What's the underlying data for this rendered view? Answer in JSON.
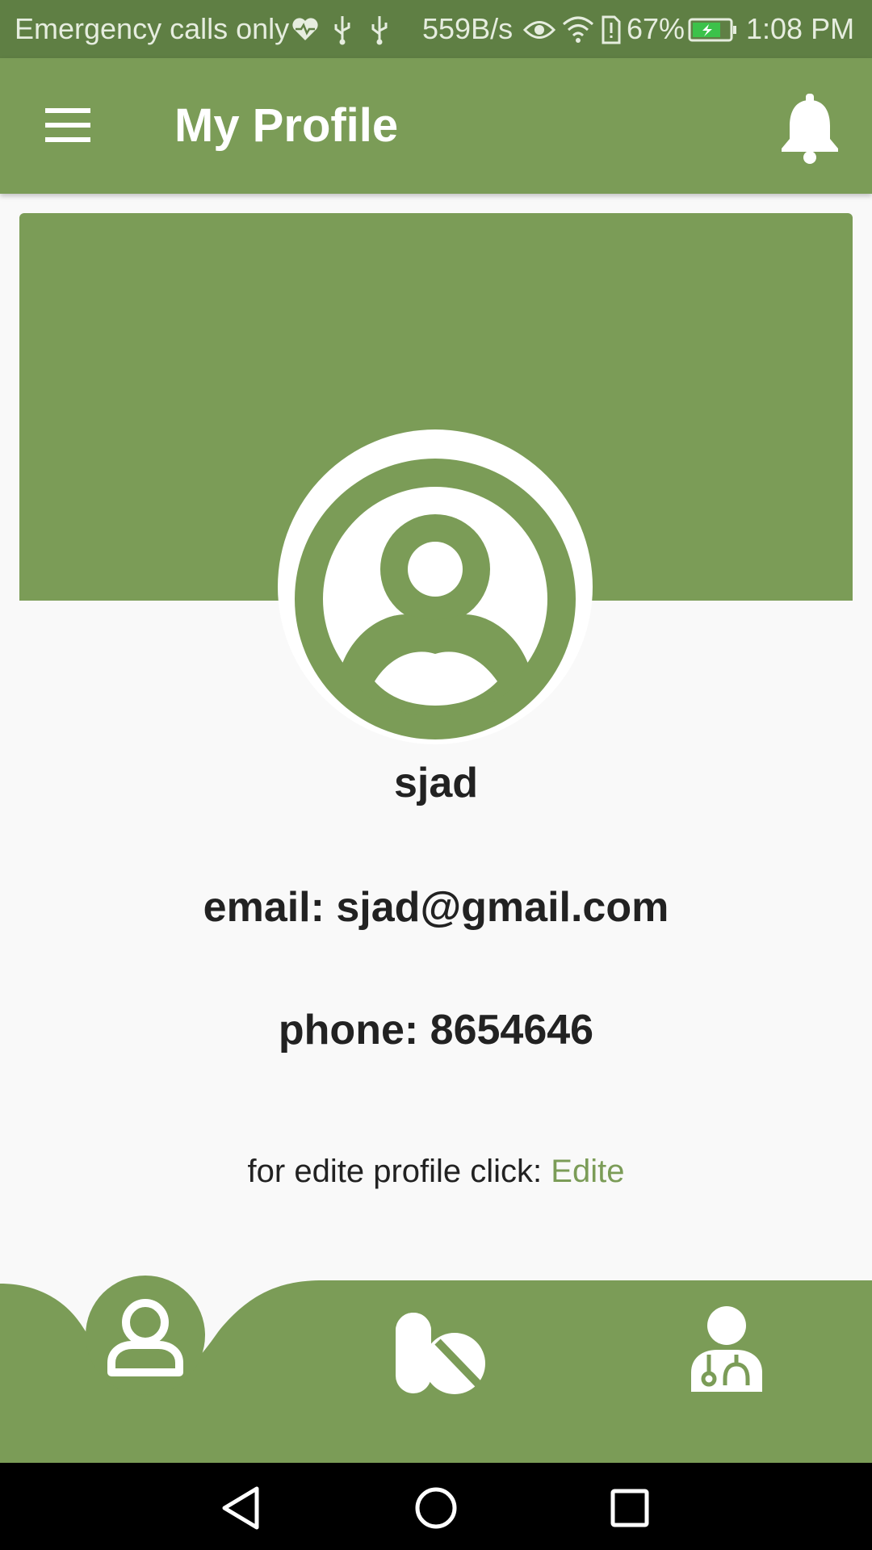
{
  "status_bar": {
    "carrier": "Emergency calls only",
    "net_speed": "559B/s",
    "battery": "67%",
    "time": "1:08 PM"
  },
  "app_bar": {
    "title": "My Profile",
    "menu_icon": "hamburger-menu-icon",
    "notification_icon": "bell-icon"
  },
  "profile": {
    "name": "sjad",
    "email_line": "email: sjad@gmail.com",
    "phone_line": "phone: 8654646",
    "edit_prompt": "for edite profile click:",
    "edit_link": "Edite"
  },
  "bottom_nav": {
    "items": [
      {
        "icon": "user-icon",
        "active": true
      },
      {
        "icon": "pills-icon",
        "active": false
      },
      {
        "icon": "doctor-icon",
        "active": false
      }
    ]
  },
  "colors": {
    "primary": "#7b9c57",
    "status_bar": "#5f7f44",
    "background": "#f9f9f9",
    "text": "#222222"
  }
}
